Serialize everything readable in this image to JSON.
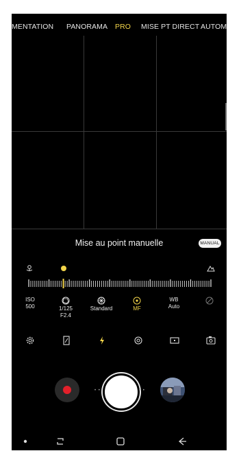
{
  "modes": [
    {
      "label": "MENTATION",
      "active": false
    },
    {
      "label": "PANORAMA",
      "active": false
    },
    {
      "label": "PRO",
      "active": true
    },
    {
      "label": "MISE PT DIRECT",
      "active": false
    },
    {
      "label": "AUTOMA",
      "active": false
    }
  ],
  "focus": {
    "title": "Mise au point manuelle",
    "badge": "MANUAL",
    "level": 0.19
  },
  "settings": [
    {
      "label": "ISO",
      "value": "500",
      "icon": "iso-text"
    },
    {
      "label": "1/125",
      "value": "F2.4",
      "icon": "aperture-icon"
    },
    {
      "label": "",
      "value": "Standard",
      "icon": "color-tone-icon"
    },
    {
      "label": "",
      "value": "MF",
      "icon": "focus-target-icon"
    },
    {
      "label": "WB",
      "value": "Auto",
      "icon": "wb-text"
    },
    {
      "label": "",
      "value": "",
      "icon": "exposure-compensation-icon"
    }
  ],
  "quick_icons": [
    "gear-icon",
    "aspect-ratio-icon",
    "flash-icon",
    "timer-icon",
    "picture-size-icon",
    "switch-camera-icon"
  ],
  "colors": {
    "accent": "#f2d44a",
    "record": "#e3202a",
    "background": "#000000"
  },
  "navbar": [
    "dot-icon",
    "recent-apps-icon",
    "home-icon",
    "back-icon"
  ]
}
